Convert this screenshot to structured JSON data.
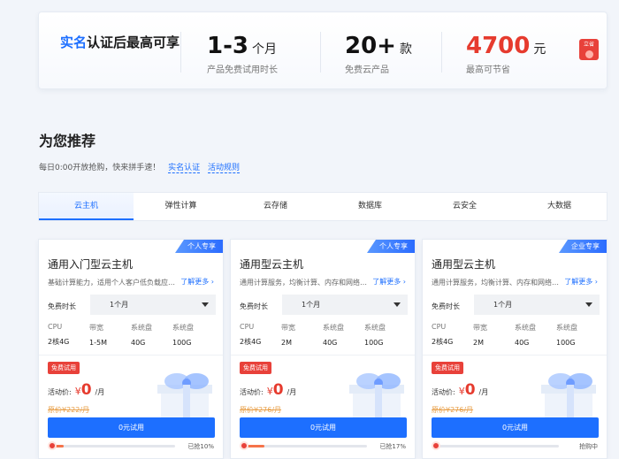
{
  "stats": {
    "lead_accent": "实名",
    "lead_rest": "认证后最高可享",
    "items": [
      {
        "value": "1-3",
        "unit": "个月",
        "caption": "产品免费试用时长"
      },
      {
        "value": "20+",
        "unit": "款",
        "caption": "免费云产品"
      },
      {
        "value": "4700",
        "unit": "元",
        "caption": "最高可节省"
      }
    ],
    "badge_label": "立省"
  },
  "section": {
    "title": "为您推荐",
    "subtitle": "每日0:00开放抢购，快来拼手速！",
    "links": [
      "实名认证",
      "活动规则"
    ]
  },
  "tabs": [
    "云主机",
    "弹性计算",
    "云存储",
    "数据库",
    "云安全",
    "大数据"
  ],
  "active_tab": 0,
  "spec_keys": [
    "CPU",
    "带宽",
    "系统盘",
    "系统盘"
  ],
  "cards": [
    {
      "tag": "个人专享",
      "title": "通用入门型云主机",
      "desc": "基础计算能力，适用个人客户低负载应…",
      "more": "了解更多",
      "duration_label": "免费时长",
      "duration_value": "1个月",
      "spec_values": [
        "2核4G",
        "1-5M",
        "40G",
        "100G"
      ],
      "free_badge": "免费试用",
      "price_label": "活动价:",
      "currency": "¥",
      "price": "0",
      "per": "/月",
      "orig_price": "原价¥222/月",
      "cta": "0元试用",
      "progress": 0.1,
      "progress_text": "已抢10%"
    },
    {
      "tag": "个人专享",
      "title": "通用型云主机",
      "desc": "通用计算服务，均衡计算、内存和网络…",
      "more": "了解更多",
      "duration_label": "免费时长",
      "duration_value": "1个月",
      "spec_values": [
        "2核4G",
        "2M",
        "40G",
        "100G"
      ],
      "free_badge": "免费试用",
      "price_label": "活动价:",
      "currency": "¥",
      "price": "0",
      "per": "/月",
      "orig_price": "原价¥276/月",
      "cta": "0元试用",
      "progress": 0.17,
      "progress_text": "已抢17%"
    },
    {
      "tag": "企业专享",
      "title": "通用型云主机",
      "desc": "通用计算服务，均衡计算、内存和网络…",
      "more": "了解更多",
      "duration_label": "免费时长",
      "duration_value": "1个月",
      "spec_values": [
        "2核4G",
        "2M",
        "40G",
        "100G"
      ],
      "free_badge": "免费试用",
      "price_label": "活动价:",
      "currency": "¥",
      "price": "0",
      "per": "/月",
      "orig_price": "原价¥276/月",
      "cta": "0元试用",
      "progress": 0.0,
      "progress_text": "抢购中"
    }
  ],
  "colors": {
    "primary": "#1d6fff",
    "price_red": "#e63b2e",
    "badge_red": "#e8413a",
    "orig_price": "#e8a04a"
  }
}
